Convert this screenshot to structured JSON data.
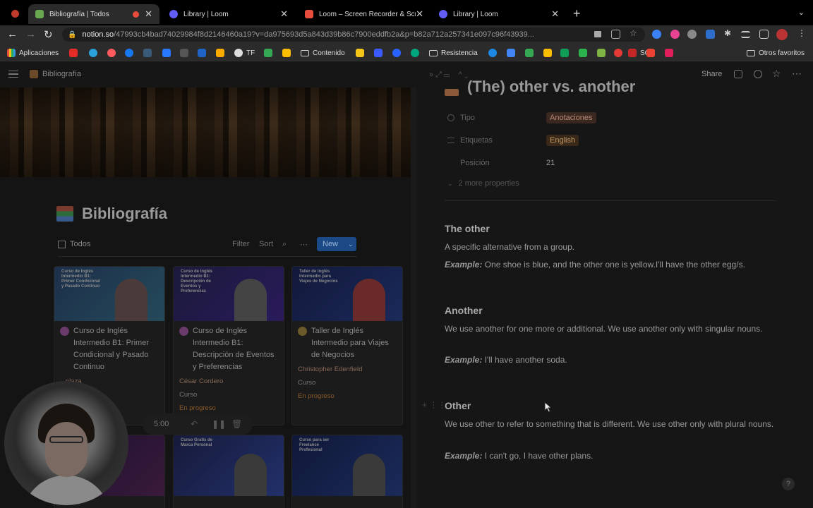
{
  "browser": {
    "tabs": [
      {
        "label": "Bibliografía | Todos",
        "favicon_color": "#6aa84f"
      },
      {
        "label": "Library | Loom",
        "favicon_color": "#625df5"
      },
      {
        "label": "Loom – Screen Recorder & Scr",
        "favicon_color": "#e74c3c"
      },
      {
        "label": "Library | Loom",
        "favicon_color": "#625df5"
      }
    ],
    "url_domain": "notion.so",
    "url_rest": "/47993cb4bad74029984f8d2146460a19?v=da975693d5a843d39b86c7900eddfb2a&p=b82a712a257341e097c96f43939...",
    "bookmarks": {
      "apps_label": "Aplicaciones",
      "tf": "TF",
      "contenido": "Contenido",
      "resistencia": "Resistencia",
      "so": "SO",
      "otros": "Otros favoritos"
    }
  },
  "notion": {
    "breadcrumb": "Bibliografía",
    "page_title": "Bibliografía",
    "view_name": "Todos",
    "filter": "Filter",
    "sort": "Sort",
    "new_button": "New",
    "cards": [
      {
        "title": "Curso de Inglés Intermedio B1: Primer Condicional y Pasado Continuo",
        "thumb_text": "Curso de Inglés Intermedio B1: Primer Condicional y Pasado Continuo",
        "author": "...plaza",
        "tipo": "",
        "estado": ""
      },
      {
        "title": "Curso de Inglés Intermedio B1: Descripción de Eventos y Preferencias",
        "thumb_text": "Curso de Inglés Intermedio B1: Descripción de Eventos y Preferencias",
        "author": "César Cordero",
        "tipo": "Curso",
        "estado": "En progreso"
      },
      {
        "title": "Taller de Inglés Intermedio para Viajes de Negocios",
        "thumb_text": "Taller de Inglés Intermedio para Viajes de Negocios",
        "author": "Christopher Edenfield",
        "tipo": "Curso",
        "estado": "En progreso"
      },
      {
        "thumb_text": ""
      },
      {
        "thumb_text": "Curso Gratis de Marca Personal"
      },
      {
        "thumb_text": "Curso para ser Freelance Profesional"
      }
    ],
    "recorder": {
      "time": "5:00"
    },
    "peek": {
      "share": "Share",
      "title": "(The) other vs. another",
      "props": [
        {
          "key": "Tipo",
          "value": "Anotaciones"
        },
        {
          "key": "Etiquetas",
          "value": "English"
        },
        {
          "key": "Posición",
          "value": "21"
        }
      ],
      "more_props": "2 more properties",
      "sections": [
        {
          "heading": "The other",
          "text": "A specific alternative from a group.",
          "example_label": "Example:",
          "example": "One shoe is blue, and the other one is yellow.I'll have the other egg/s."
        },
        {
          "heading": "Another",
          "text": "We use another for one more or additional. We use another only with singular nouns.",
          "example_label": "Example:",
          "example": "I'll have another soda."
        },
        {
          "heading": "Other",
          "text": "We use other to refer to something that is different. We use other only with plural nouns.",
          "example_label": "Example:",
          "example": "I can't go, I have other plans."
        }
      ]
    },
    "help": "?"
  }
}
